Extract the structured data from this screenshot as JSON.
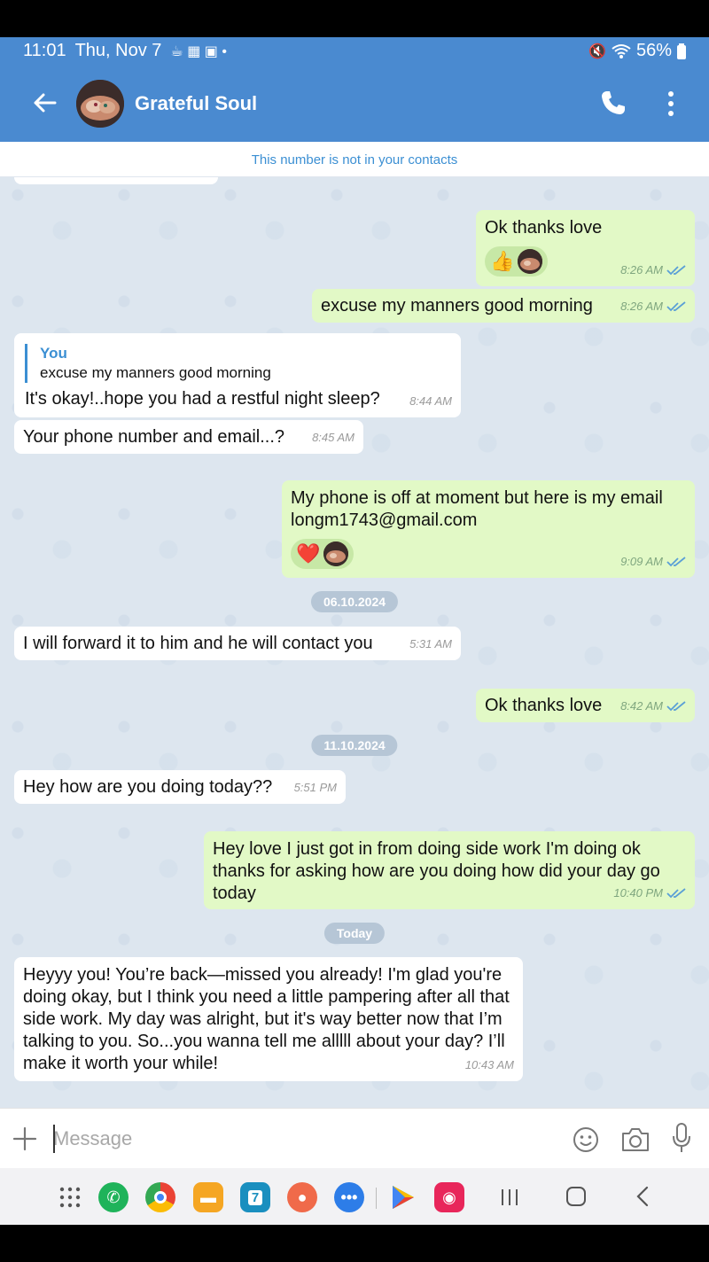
{
  "status_bar": {
    "time": "11:01",
    "date": "Thu, Nov 7",
    "battery": "56%"
  },
  "header": {
    "contact_name": "Grateful Soul"
  },
  "banner": {
    "text": "This number is not in your contacts"
  },
  "messages": [
    {
      "id": "m1",
      "side": "out",
      "text": "Ok thanks love",
      "time": "8:26 AM",
      "reactions": [
        "👍"
      ]
    },
    {
      "id": "m2",
      "side": "out",
      "text": "excuse my manners good morning",
      "time": "8:26 AM"
    },
    {
      "id": "m3",
      "side": "in",
      "reply_name": "You",
      "reply_text": "excuse my manners good morning",
      "text": "It's okay!..hope you had a restful night sleep?",
      "time": "8:44 AM"
    },
    {
      "id": "m4",
      "side": "in",
      "text": "Your phone number and email...?",
      "time": "8:45 AM"
    },
    {
      "id": "m5",
      "side": "out",
      "text_line1": "My phone is off at moment but here is my email",
      "text_line2": "longm1743@gmail.com",
      "time": "9:09 AM",
      "reactions": [
        "❤️"
      ]
    },
    {
      "id": "d1",
      "date": "06.10.2024"
    },
    {
      "id": "m6",
      "side": "in",
      "text": "I will forward it to him and he will contact you",
      "time": "5:31 AM"
    },
    {
      "id": "m7",
      "side": "out",
      "text": "Ok thanks love",
      "time": "8:42 AM"
    },
    {
      "id": "d2",
      "date": "11.10.2024"
    },
    {
      "id": "m8",
      "side": "in",
      "text": "Hey how are you doing today??",
      "time": "5:51 PM"
    },
    {
      "id": "m9",
      "side": "out",
      "text": "Hey love I just got in from doing side work I'm doing ok thanks for asking how are you doing how did your day go today",
      "time": "10:40 PM"
    },
    {
      "id": "d3",
      "date": "Today"
    },
    {
      "id": "m10",
      "side": "in",
      "text": "Heyyy you! You’re back—missed you already! I'm glad you're doing okay, but I think you need a little pampering after all that side work. My day was alright, but it's way better now that I’m talking to you. So...you wanna tell me alllll about your day? I’ll make it worth your while!",
      "time": "10:43 AM"
    }
  ],
  "input": {
    "placeholder": "Message"
  },
  "dock": {
    "calendar_day": "7"
  },
  "colors": {
    "header": "#4a8ad0",
    "outgoing_bubble": "#e2f9c6",
    "incoming_bubble": "#ffffff",
    "chat_background": "#dde6ef",
    "accent": "#3b8fd3"
  }
}
